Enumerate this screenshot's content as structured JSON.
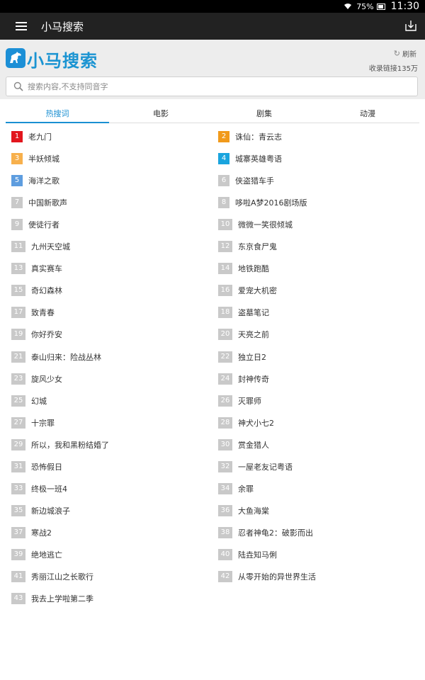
{
  "status_bar": {
    "battery": "75%",
    "time": "11:30"
  },
  "app_bar": {
    "title": "小马搜索"
  },
  "header": {
    "brand": "小马搜索",
    "refresh_label": "刷新",
    "index_count": "收录链接135万"
  },
  "search": {
    "placeholder": "搜索内容,不支持同音字"
  },
  "tabs": [
    "热搜词",
    "电影",
    "剧集",
    "动漫"
  ],
  "colors": {
    "accent": "#1a8fd2",
    "rank1": "#e2161d",
    "rank2": "#f19a1b",
    "rank3": "#f7b04c",
    "rank4": "#1aa4de",
    "rank5": "#5e9ddf",
    "rank_default": "#c9c9c9"
  },
  "hot_list": [
    {
      "rank": "1",
      "title": "老九门"
    },
    {
      "rank": "2",
      "title": "诛仙：青云志"
    },
    {
      "rank": "3",
      "title": "半妖倾城"
    },
    {
      "rank": "4",
      "title": "城寨英雄粤语"
    },
    {
      "rank": "5",
      "title": "海洋之歌"
    },
    {
      "rank": "6",
      "title": "侠盗猎车手"
    },
    {
      "rank": "7",
      "title": "中国新歌声"
    },
    {
      "rank": "8",
      "title": "哆啦A梦2016剧场版"
    },
    {
      "rank": "9",
      "title": "使徒行者"
    },
    {
      "rank": "10",
      "title": "微微一笑很倾城"
    },
    {
      "rank": "11",
      "title": "九州天空城"
    },
    {
      "rank": "12",
      "title": "东京食尸鬼"
    },
    {
      "rank": "13",
      "title": "真实赛车"
    },
    {
      "rank": "14",
      "title": "地铁跑酷"
    },
    {
      "rank": "15",
      "title": "奇幻森林"
    },
    {
      "rank": "16",
      "title": "爱宠大机密"
    },
    {
      "rank": "17",
      "title": "致青春"
    },
    {
      "rank": "18",
      "title": "盗墓笔记"
    },
    {
      "rank": "19",
      "title": "你好乔安"
    },
    {
      "rank": "20",
      "title": "天亮之前"
    },
    {
      "rank": "21",
      "title": "泰山归来：险战丛林"
    },
    {
      "rank": "22",
      "title": "独立日2"
    },
    {
      "rank": "23",
      "title": "旋风少女"
    },
    {
      "rank": "24",
      "title": "封神传奇"
    },
    {
      "rank": "25",
      "title": "幻城"
    },
    {
      "rank": "26",
      "title": "灭罪师"
    },
    {
      "rank": "27",
      "title": "十宗罪"
    },
    {
      "rank": "28",
      "title": "神犬小七2"
    },
    {
      "rank": "29",
      "title": "所以，我和黑粉结婚了"
    },
    {
      "rank": "30",
      "title": "赏金猎人"
    },
    {
      "rank": "31",
      "title": "恐怖假日"
    },
    {
      "rank": "32",
      "title": "一屋老友记粤语"
    },
    {
      "rank": "33",
      "title": "终极一班4"
    },
    {
      "rank": "34",
      "title": "余罪"
    },
    {
      "rank": "35",
      "title": "新边城浪子"
    },
    {
      "rank": "36",
      "title": "大鱼海棠"
    },
    {
      "rank": "37",
      "title": "寒战2"
    },
    {
      "rank": "38",
      "title": "忍者神龟2：破影而出"
    },
    {
      "rank": "39",
      "title": "绝地逃亡"
    },
    {
      "rank": "40",
      "title": "陆垚知马俐"
    },
    {
      "rank": "41",
      "title": "秀丽江山之长歌行"
    },
    {
      "rank": "42",
      "title": "从零开始的异世界生活"
    },
    {
      "rank": "43",
      "title": "我去上学啦第二季"
    }
  ]
}
